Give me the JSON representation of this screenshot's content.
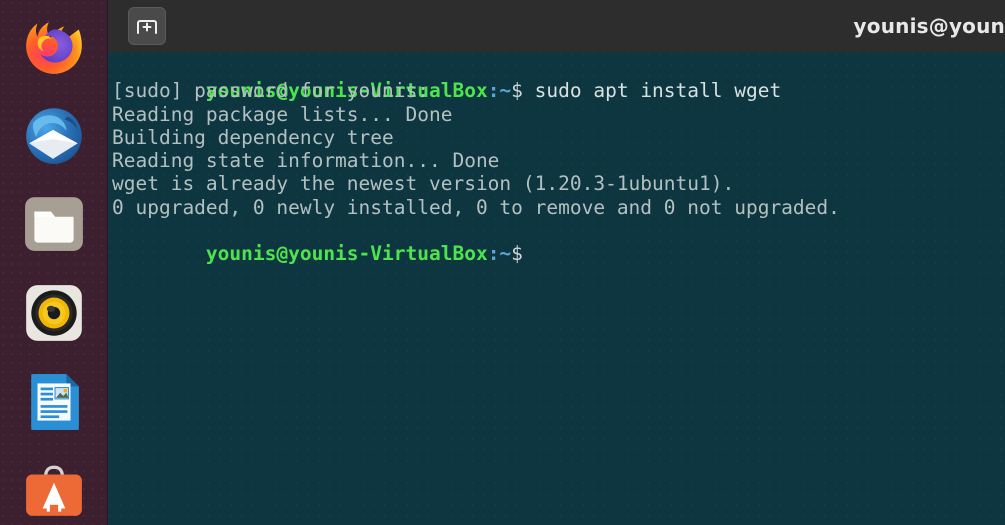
{
  "window": {
    "title": "younis@youn",
    "new_tab_label": "New Tab",
    "new_tab_icon": "new-tab-plus-icon"
  },
  "dock": {
    "items": [
      {
        "name": "firefox",
        "label": "Firefox Web Browser",
        "icon": "firefox-icon"
      },
      {
        "name": "thunderbird",
        "label": "Thunderbird Mail",
        "icon": "thunderbird-mail-icon"
      },
      {
        "name": "files",
        "label": "Files",
        "icon": "folder-icon"
      },
      {
        "name": "rhythmbox",
        "label": "Rhythmbox",
        "icon": "music-player-icon"
      },
      {
        "name": "libreoffice-writer",
        "label": "LibreOffice Writer",
        "icon": "document-writer-icon"
      },
      {
        "name": "ubuntu-software",
        "label": "Ubuntu Software",
        "icon": "software-store-icon"
      }
    ]
  },
  "terminal": {
    "prompt": {
      "user_host": "younis@younis-VirtualBox",
      "path": ":~",
      "sigil": "$"
    },
    "lines": [
      {
        "type": "prompt",
        "command": " sudo apt install wget"
      },
      {
        "type": "output",
        "text": "[sudo] password for younis:"
      },
      {
        "type": "output",
        "text": "Reading package lists... Done"
      },
      {
        "type": "output",
        "text": "Building dependency tree"
      },
      {
        "type": "output",
        "text": "Reading state information... Done"
      },
      {
        "type": "output",
        "text": "wget is already the newest version (1.20.3-1ubuntu1)."
      },
      {
        "type": "output",
        "text": "0 upgraded, 0 newly installed, 0 to remove and 0 not upgraded."
      },
      {
        "type": "prompt",
        "command": " "
      }
    ]
  },
  "colors": {
    "terminal_bg": "#0d3640",
    "titlebar_bg": "#2d2d2d",
    "dock_bg": "#3c2030",
    "prompt_green": "#4ee44e",
    "prompt_blue": "#5ba7d4",
    "text_fg": "#b8c4c4"
  }
}
